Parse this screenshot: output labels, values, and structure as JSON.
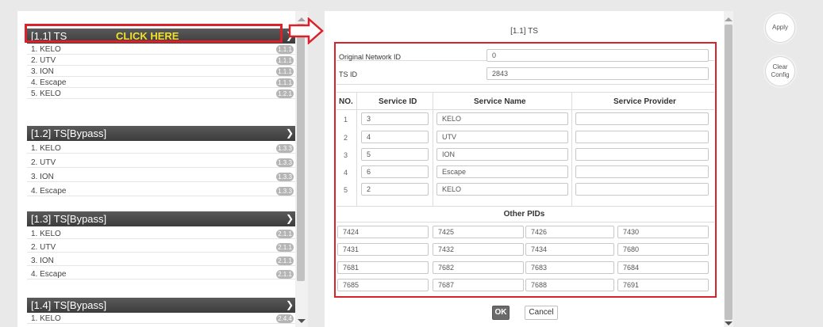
{
  "annotation": {
    "click_here": "CLICK HERE"
  },
  "groups": [
    {
      "title": "[1.1] TS",
      "items": [
        {
          "label": "1. KELO",
          "badge": "1.1.1"
        },
        {
          "label": "2. UTV",
          "badge": "1.1.1"
        },
        {
          "label": "3. ION",
          "badge": "1.1.1"
        },
        {
          "label": "4. Escape",
          "badge": "1.1.1"
        },
        {
          "label": "5. KELO",
          "badge": "1.2.1"
        }
      ]
    },
    {
      "title": "[1.2] TS[Bypass]",
      "items": [
        {
          "label": "1. KELO",
          "badge": "1.3.3"
        },
        {
          "label": "2. UTV",
          "badge": "1.3.3"
        },
        {
          "label": "3. ION",
          "badge": "1.3.3"
        },
        {
          "label": "4. Escape",
          "badge": "1.3.3"
        }
      ]
    },
    {
      "title": "[1.3] TS[Bypass]",
      "items": [
        {
          "label": "1. KELO",
          "badge": "2.1.1"
        },
        {
          "label": "2. UTV",
          "badge": "2.1.1"
        },
        {
          "label": "3. ION",
          "badge": "2.1.1"
        },
        {
          "label": "4. Escape",
          "badge": "2.1.1"
        }
      ]
    },
    {
      "title": "[1.4] TS[Bypass]",
      "items": [
        {
          "label": "1. KELO",
          "badge": "2.4.4"
        }
      ]
    }
  ],
  "detail": {
    "title": "[1.1] TS",
    "original_network_id_label": "Original Network ID",
    "original_network_id": "0",
    "ts_id_label": "TS ID",
    "ts_id": "2843",
    "headers": {
      "no": "NO.",
      "service_id": "Service ID",
      "service_name": "Service Name",
      "service_provider": "Service Provider"
    },
    "services": [
      {
        "no": "1",
        "service_id": "3",
        "service_name": "KELO",
        "service_provider": ""
      },
      {
        "no": "2",
        "service_id": "4",
        "service_name": "UTV",
        "service_provider": ""
      },
      {
        "no": "3",
        "service_id": "5",
        "service_name": "ION",
        "service_provider": ""
      },
      {
        "no": "4",
        "service_id": "6",
        "service_name": "Escape",
        "service_provider": ""
      },
      {
        "no": "5",
        "service_id": "2",
        "service_name": "KELO",
        "service_provider": ""
      }
    ],
    "other_pids_label": "Other PIDs",
    "other_pids": [
      [
        "7424",
        "7425",
        "7426",
        "7430"
      ],
      [
        "7431",
        "7432",
        "7434",
        "7680"
      ],
      [
        "7681",
        "7682",
        "7683",
        "7684"
      ],
      [
        "7685",
        "7687",
        "7688",
        "7691"
      ]
    ],
    "ok_label": "OK",
    "cancel_label": "Cancel"
  },
  "actions": {
    "apply": "Apply",
    "clear_line1": "Clear",
    "clear_line2": "Config"
  },
  "colors": {
    "highlight": "#d9222a",
    "click_here": "#f2e02a",
    "header_bg": "#4a4a4a",
    "badge": "#b5b5b5",
    "ok_bg": "#6a6a6a"
  }
}
